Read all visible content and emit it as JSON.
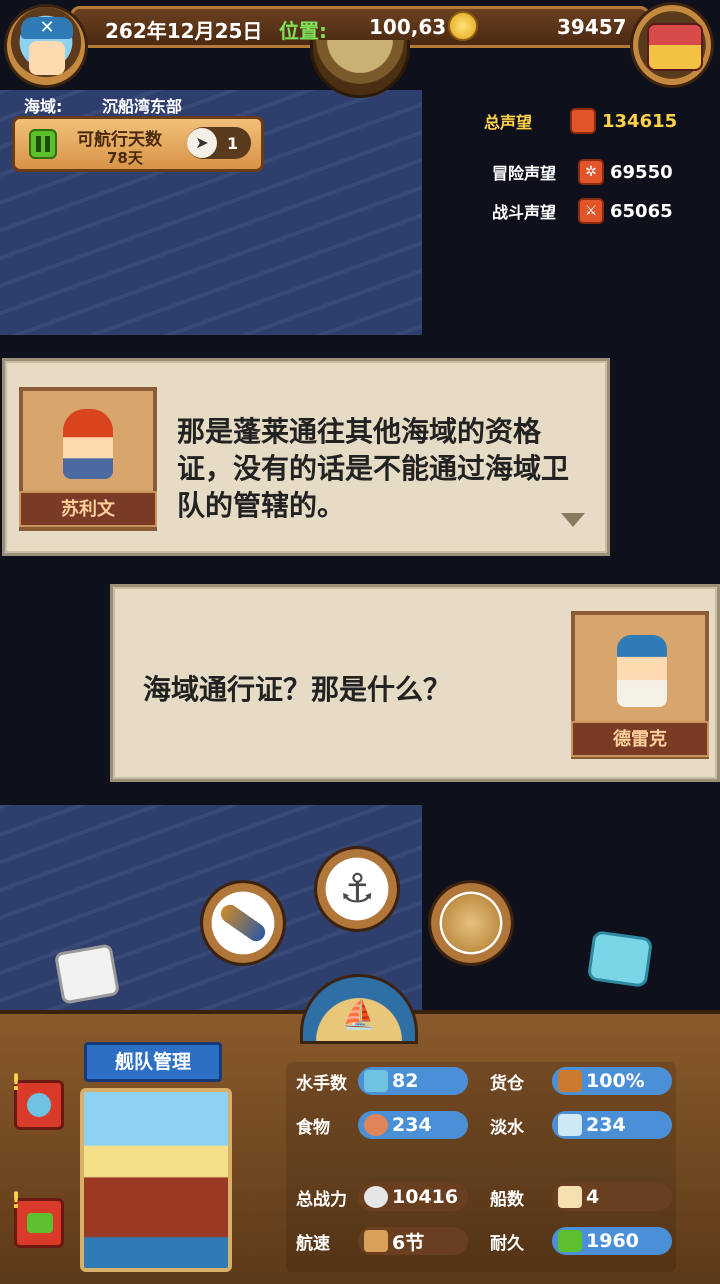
{
  "header": {
    "date": "262年12月25日",
    "position_label": "位置:",
    "position_value": "100,63",
    "gold": "39457",
    "region_label": "海域:",
    "region_value": "沉船湾东部",
    "sail_days_label": "可航行天数",
    "sail_days_value": "78天",
    "compass_count": "1"
  },
  "reputation": {
    "total_label": "总声望",
    "total_value": "134615",
    "adventure_label": "冒险声望",
    "adventure_value": "69550",
    "combat_label": "战斗声望",
    "combat_value": "65065"
  },
  "dialogs": [
    {
      "speaker": "苏利文",
      "text": "那是蓬莱通往其他海域的资格证，没有的话是不能通过海域卫队的管辖的。"
    },
    {
      "speaker": "德雷克",
      "text": "海域通行证？那是什么？"
    }
  ],
  "fleet": {
    "title": "舰队管理",
    "stats": {
      "sailors_label": "水手数",
      "sailors_value": "82",
      "cargo_label": "货仓",
      "cargo_value": "100%",
      "food_label": "食物",
      "food_value": "234",
      "water_label": "淡水",
      "water_value": "234",
      "power_label": "总战力",
      "power_value": "10416",
      "ships_label": "船数",
      "ships_value": "4",
      "speed_label": "航速",
      "speed_value": "6节",
      "durability_label": "耐久",
      "durability_value": "1960"
    }
  },
  "colors": {
    "accent_blue": "#4b8fd6",
    "reputation_gold": "#ffd24a",
    "nameplate": "#7a3b26"
  }
}
